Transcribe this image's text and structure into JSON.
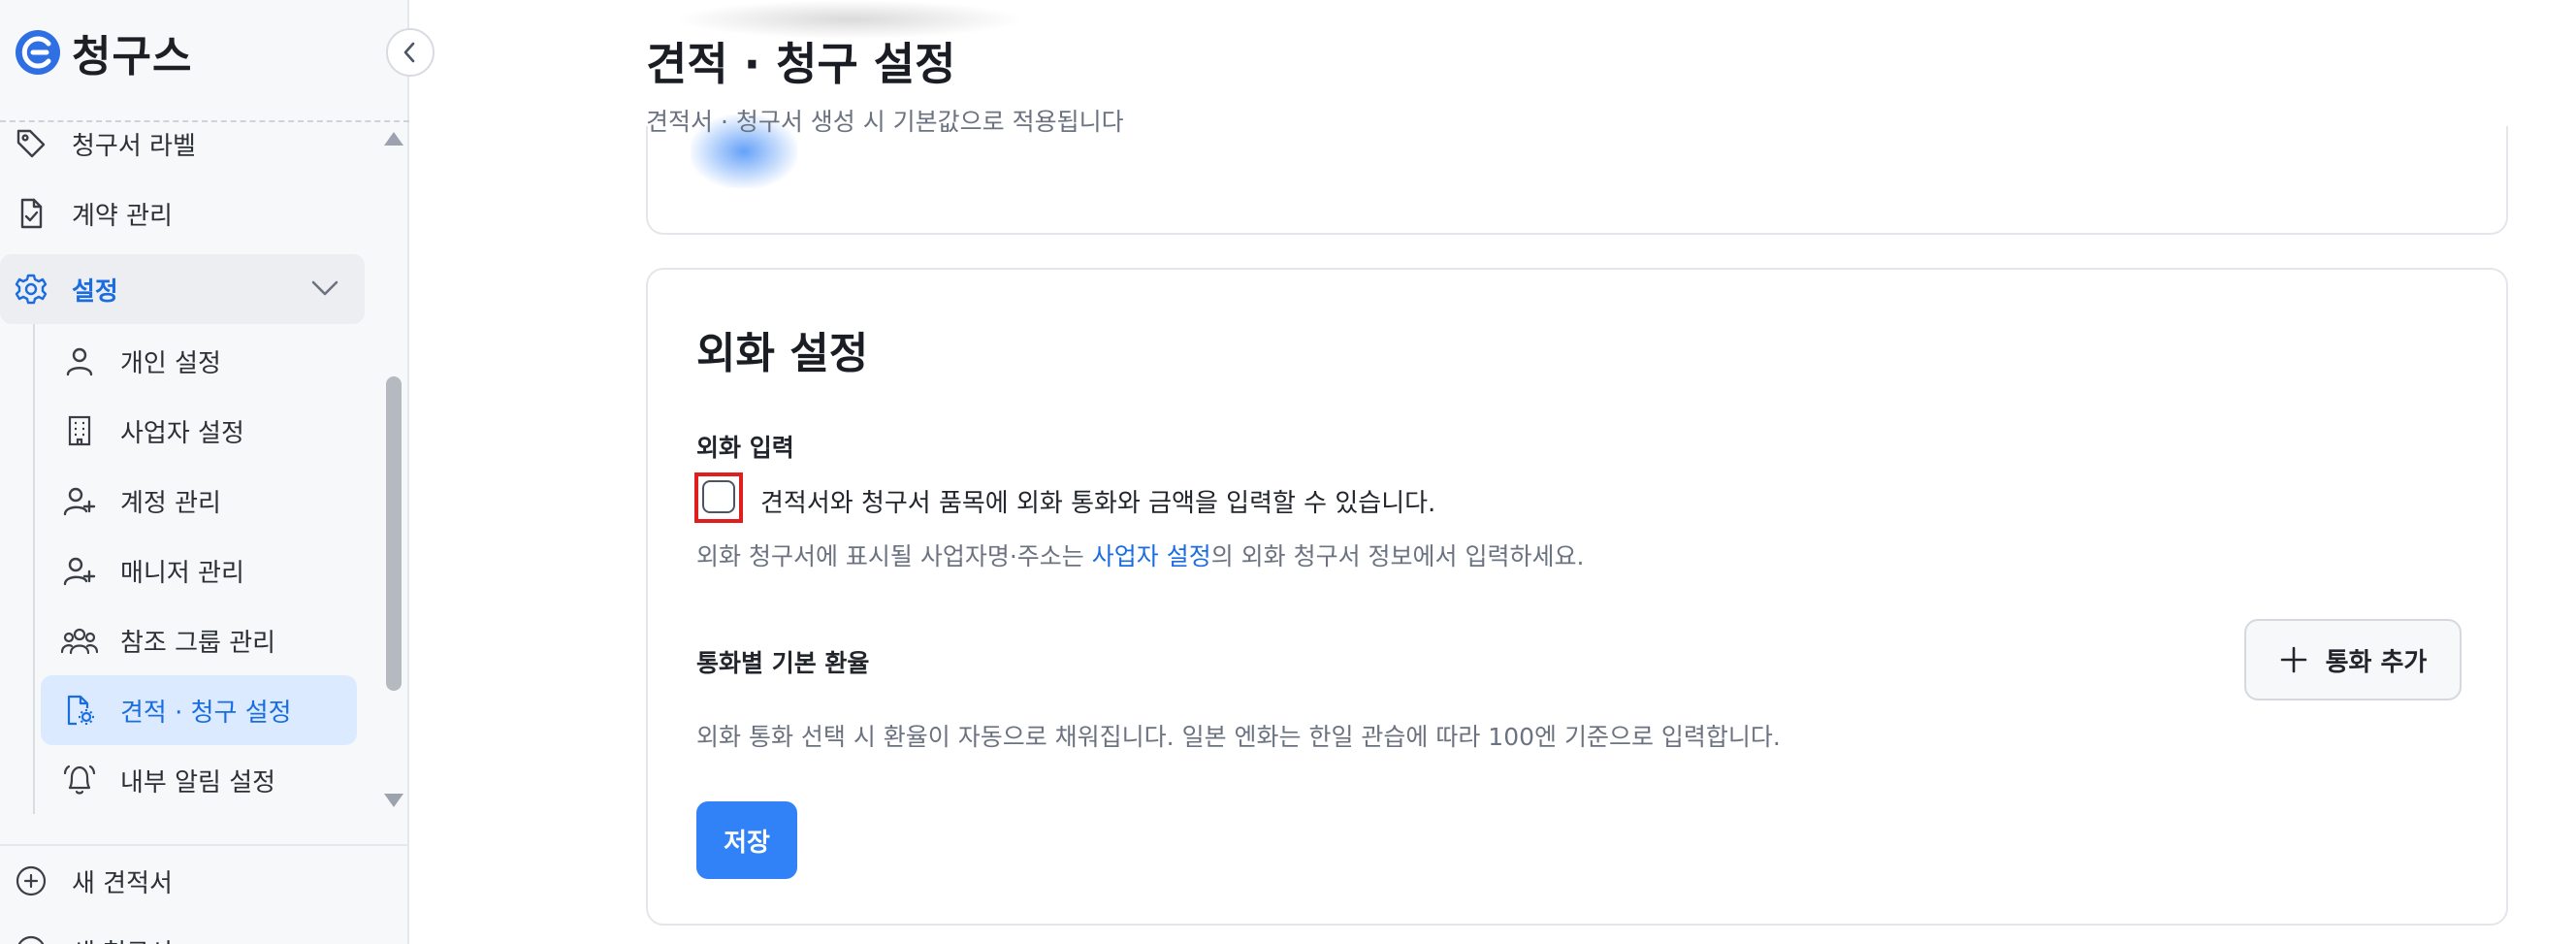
{
  "app": {
    "brand_name": "청구스"
  },
  "sidebar": {
    "items": [
      {
        "label": "청구서 라벨",
        "icon": "tag-icon"
      },
      {
        "label": "계약 관리",
        "icon": "document-check-icon"
      },
      {
        "label": "설정",
        "icon": "gear-icon",
        "expanded": true
      }
    ],
    "settings_children": [
      {
        "label": "개인 설정",
        "icon": "user-icon"
      },
      {
        "label": "사업자 설정",
        "icon": "building-icon"
      },
      {
        "label": "계정 관리",
        "icon": "user-plus-icon"
      },
      {
        "label": "매니저 관리",
        "icon": "user-plus-icon"
      },
      {
        "label": "참조 그룹 관리",
        "icon": "users-group-icon"
      },
      {
        "label": "견적 · 청구 설정",
        "icon": "file-gear-icon",
        "active": true
      },
      {
        "label": "내부 알림 설정",
        "icon": "bell-icon"
      }
    ],
    "bottom_items": [
      {
        "label": "새 견적서",
        "icon": "plus-circle-icon"
      },
      {
        "label": "새 청구서",
        "icon": "plus-circle-icon"
      }
    ]
  },
  "header": {
    "title": "견적 · 청구 설정",
    "subtitle": "견적서 · 청구서 생성 시 기본값으로 적용됩니다"
  },
  "fx_section": {
    "title": "외화 설정",
    "input_label": "외화 입력",
    "checkbox_label": "견적서와 청구서 품목에 외화 통화와 금액을 입력할 수 있습니다.",
    "checkbox_checked": false,
    "help_before": "외화 청구서에 표시될 사업자명·주소는 ",
    "help_link": "사업자 설정",
    "help_after": "의 외화 청구서 정보에서 입력하세요.",
    "rate_label": "통화별 기본 환율",
    "add_currency_label": "통화 추가",
    "rate_help": "외화 통화 선택 시 환율이 자동으로 채워집니다. 일본 엔화는 한일 관습에 따라 100엔 기준으로 입력합니다.",
    "save_label": "저장"
  },
  "colors": {
    "accent": "#3182f6",
    "link": "#1a6de0",
    "highlight": "#e01e1e",
    "active_bg": "#dbeafe"
  }
}
